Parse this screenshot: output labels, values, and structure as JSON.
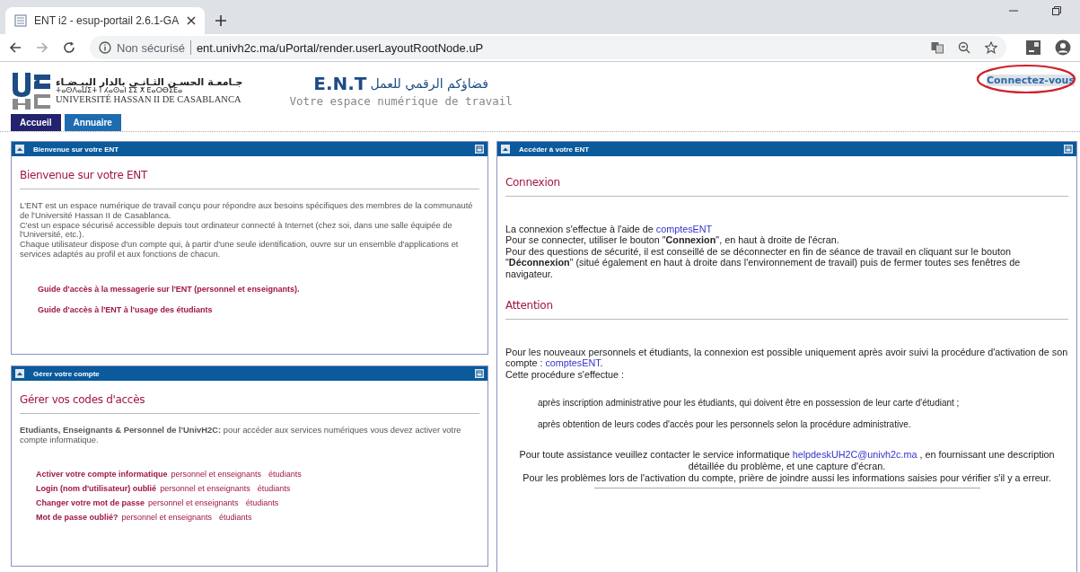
{
  "browser": {
    "tab_title": "ENT i2 - esup-portail 2.6.1-GA",
    "security": "Non sécurisé",
    "url": "ent.univh2c.ma/uPortal/render.userLayoutRootNode.uP"
  },
  "header": {
    "university_arabic": "جـامعـة الحسـن الثـانـي بالدار البيـضـاء",
    "university_tifinagh": "ⵜⴰⵙⴷⴰⵡⵉⵜ ⵏ ⵃⴰⵙⴰⵏ ⵉⵉ ⵅ ⴹⴰⵔⴱⵉⴹⴰ",
    "university_name": "UNIVERSITÉ HASSAN II DE CASABLANCA",
    "ent_logo": "E.N.T",
    "ent_arabic": "فضاؤكم الرقمي للعمل",
    "ent_tagline": "Votre espace numérique de travail",
    "login_link": "Connectez-vous",
    "login_circled": true
  },
  "nav_tabs": [
    {
      "label": "Accueil",
      "selected": true
    },
    {
      "label": "Annuaire",
      "selected": false
    }
  ],
  "columns": [
    {
      "portlets": [
        {
          "title": "Bienvenue sur votre ENT",
          "blocks": [
            {
              "kind": "heading",
              "text": "Bienvenue sur votre ENT"
            },
            {
              "kind": "para",
              "lines": [
                [
                  {
                    "kind": "text",
                    "text": "L'ENT est un espace numérique de travail conçu pour répondre aux besoins spécifiques des membres de la communauté de l'Université Hassan II de Casablanca."
                  }
                ],
                [
                  {
                    "kind": "text",
                    "text": "C'est un espace sécurisé accessible depuis tout ordinateur connecté à Internet (chez soi, dans une salle équipée de l'Université, etc.)."
                  }
                ],
                [
                  {
                    "kind": "text",
                    "text": "Chaque utilisateur dispose d'un compte qui, à partir d'une seule identification, ouvre sur un ensemble d'applications et services adaptés au profil et aux fonctions de chacun."
                  }
                ]
              ]
            },
            {
              "kind": "links",
              "items": [
                "Guide d'accès à la messagerie sur l'ENT (personnel et enseignants).",
                "Guide d'accès à l'ENT à l'usage des étudiants"
              ]
            }
          ]
        },
        {
          "title": "Gérer votre compte",
          "blocks": [
            {
              "kind": "heading",
              "text": "Gérer vos codes d'accès"
            },
            {
              "kind": "para",
              "lines": [
                [
                  {
                    "kind": "text",
                    "text": "**Etudiants, Enseignants & Personnel de l'UnivH2C:** pour accéder aux services numériques vous devez activer votre compte informatique."
                  }
                ]
              ]
            },
            {
              "kind": "account",
              "rows": [
                {
                  "label": "Activer votre compte informatique",
                  "links": [
                    "personnel et enseignants",
                    "étudiants"
                  ]
                },
                {
                  "label": "Login (nom d'utilisateur) oublié",
                  "links": [
                    "personnel et enseignants",
                    "étudiants"
                  ]
                },
                {
                  "label": "Changer votre mot de passe",
                  "links": [
                    "personnel et enseignants",
                    "étudiants"
                  ]
                },
                {
                  "label": "Mot de passe oublié?",
                  "links": [
                    "personnel et enseignants",
                    "étudiants"
                  ]
                }
              ]
            }
          ]
        }
      ]
    },
    {
      "portlets": [
        {
          "title": "Accéder à votre ENT",
          "blocks": [
            {
              "kind": "heading",
              "text": "Connexion"
            },
            {
              "kind": "para",
              "lines": [
                [
                  {
                    "kind": "text",
                    "text": "La connexion s'effectue à l'aide de "
                  },
                  {
                    "kind": "link",
                    "text": "comptesENT"
                  }
                ],
                [
                  {
                    "kind": "text",
                    "text": "Pour se connecter, utiliser le bouton \"**Connexion**\", en haut à droite de l'écran."
                  }
                ],
                [
                  {
                    "kind": "text",
                    "text": "Pour des questions de sécurité, il est conseillé de se déconnecter en fin de séance de travail en cliquant sur le bouton \"**Déconnexion**\" (situé également en haut à droite dans l'environnement de travail) puis de fermer toutes ses fenêtres de navigateur."
                  }
                ]
              ]
            },
            {
              "kind": "heading",
              "text": "Attention"
            },
            {
              "kind": "para",
              "lines": [
                [
                  {
                    "kind": "text",
                    "text": "Pour les nouveaux personnels et étudiants, la connexion est possible uniquement après avoir suivi la procédure d'activation de son compte : "
                  },
                  {
                    "kind": "link",
                    "text": "comptesENT"
                  },
                  {
                    "kind": "text",
                    "text": "."
                  }
                ],
                [
                  {
                    "kind": "text",
                    "text": "Cette procédure s'effectue :"
                  }
                ]
              ]
            },
            {
              "kind": "indent",
              "items": [
                "après inscription administrative pour les étudiants, qui doivent être en possession de leur carte d'étudiant ;",
                "après obtention de leurs codes d'accès pour les personnels selon la procédure administrative."
              ]
            },
            {
              "kind": "center",
              "lines": [
                [
                  {
                    "kind": "text",
                    "text": "Pour toute assistance veuillez contacter le service informatique "
                  },
                  {
                    "kind": "link",
                    "text": "helpdeskUH2C@univh2c.ma"
                  },
                  {
                    "kind": "text",
                    "text": " , en fournissant une description détaillée du problème, et une capture d'écran."
                  }
                ],
                [
                  {
                    "kind": "text",
                    "text": "Pour les problèmes lors de l'activation du compte, prière de joindre aussi les informations saisies pour vérifier s'il y a erreur."
                  }
                ]
              ]
            }
          ]
        }
      ]
    }
  ]
}
